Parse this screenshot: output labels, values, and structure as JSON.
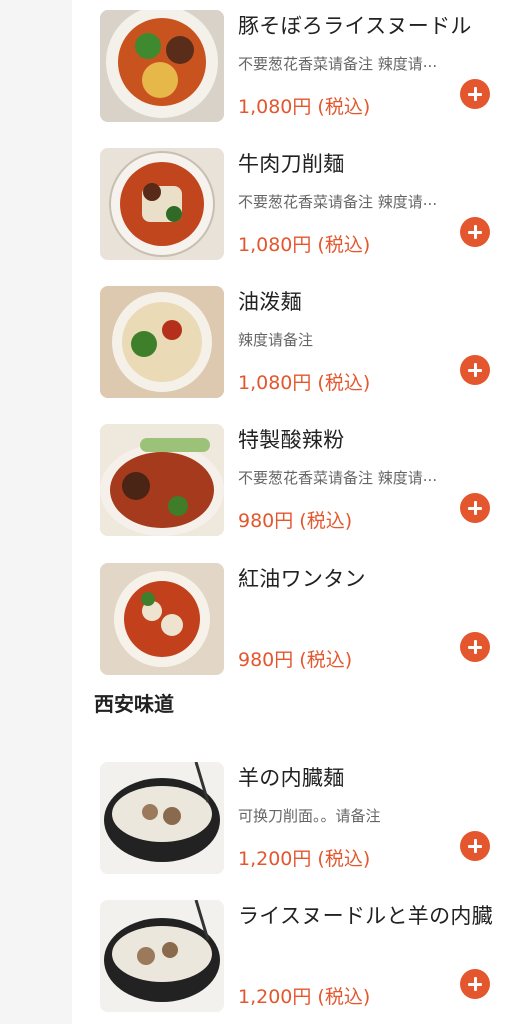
{
  "colors": {
    "price": "#e4572e",
    "add_button": "#e4572e",
    "rail": "#f5f5f5"
  },
  "items_top": [
    {
      "name": "豚そぼろライスヌードル",
      "desc": "不要葱花香菜请备注 辣度请",
      "truncated": true,
      "price": "1,080円 (税込)",
      "image": "noodle-bowl-chickpea-image"
    },
    {
      "name": "牛肉刀削麺",
      "desc": "不要葱花香菜请备注 辣度请",
      "truncated": true,
      "price": "1,080円 (税込)",
      "image": "beef-noodle-bowl-image"
    },
    {
      "name": "油泼麺",
      "desc": "辣度请备注",
      "truncated": false,
      "price": "1,080円 (税込)",
      "image": "oil-noodle-bowl-image"
    },
    {
      "name": "特製酸辣粉",
      "desc": "不要葱花香菜请备注 辣度请",
      "truncated": true,
      "price": "980円 (税込)",
      "image": "hot-sour-noodle-image"
    },
    {
      "name": "紅油ワンタン",
      "desc": "",
      "truncated": false,
      "price": "980円 (税込)",
      "image": "wonton-bowl-image"
    }
  ],
  "section": {
    "title": "西安味道"
  },
  "items_bottom": [
    {
      "name": "羊の内臓麺",
      "desc": "可换刀削面。。请备注",
      "truncated": false,
      "price": "1,200円 (税込)",
      "image": "lamb-offal-noodle-image"
    },
    {
      "name": "ライスヌードルと羊の内臓",
      "desc": "",
      "truncated": false,
      "price": "1,200円 (税込)",
      "image": "lamb-offal-rice-noodle-image"
    }
  ]
}
